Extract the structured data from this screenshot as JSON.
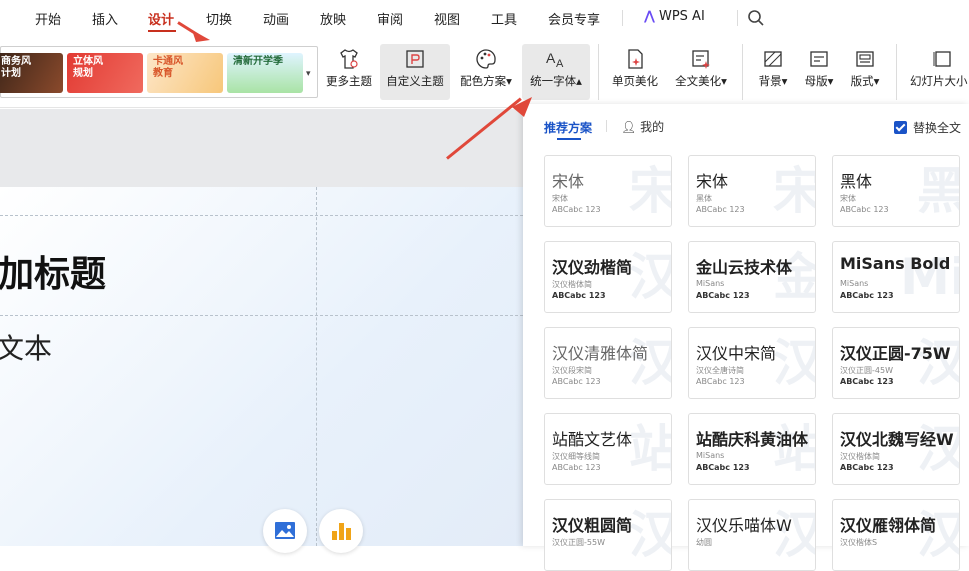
{
  "menubar": {
    "items": [
      "开始",
      "插入",
      "设计",
      "切换",
      "动画",
      "放映",
      "审阅",
      "视图",
      "工具",
      "会员专享"
    ],
    "active": "设计",
    "ai_label": "WPS AI"
  },
  "ribbon": {
    "themes": [
      {
        "label": "商务风\n计划",
        "color": "#6b3b2a"
      },
      {
        "label": "立体风\n规划",
        "color": "#e8473f"
      },
      {
        "label": "卡通风\n教育",
        "color": "#f5b340"
      },
      {
        "label": "清新开学季",
        "color": "#48b26b"
      }
    ],
    "buttons": {
      "more_themes": "更多主题",
      "custom_theme": "自定义主题",
      "color_scheme": "配色方案",
      "unify_font": "统一字体",
      "page_beautify": "单页美化",
      "full_beautify": "全文美化",
      "background": "背景",
      "master": "母版",
      "layout": "版式",
      "slide_size": "幻灯片大小"
    }
  },
  "slide": {
    "title": "加标题",
    "subtitle": "文本"
  },
  "font_panel": {
    "tab_recommended": "推荐方案",
    "tab_mine": "我的",
    "replace_all": "替换全文",
    "replace_all_checked": true,
    "cards": [
      {
        "name": "宋体",
        "sub": "宋体",
        "sample": "ABCabc 123",
        "wm": "宋",
        "light": true
      },
      {
        "name": "宋体",
        "sub": "黑体",
        "sample": "ABCabc 123",
        "wm": "宋"
      },
      {
        "name": "黑体",
        "sub": "宋体",
        "sample": "ABCabc 123",
        "wm": "黑"
      },
      {
        "name": "汉仪劲楷简",
        "sub": "汉仪楷体简",
        "sample": "ABCabc 123",
        "wm": "汉",
        "bold": true
      },
      {
        "name": "金山云技术体",
        "sub": "MiSans",
        "sample": "ABCabc 123",
        "wm": "金",
        "bold": true
      },
      {
        "name": "MiSans Bold",
        "sub": "MiSans",
        "sample": "ABCabc 123",
        "wm": "Mi",
        "bold": true
      },
      {
        "name": "汉仪清雅体简",
        "sub": "汉仪段宋简",
        "sample": "ABCabc 123",
        "wm": "汉",
        "light": true
      },
      {
        "name": "汉仪中宋简",
        "sub": "汉仪全唐诗简",
        "sample": "ABCabc 123",
        "wm": "汉"
      },
      {
        "name": "汉仪正圆-75W",
        "sub": "汉仪正圆-45W",
        "sample": "ABCabc 123",
        "wm": "汉",
        "bold": true
      },
      {
        "name": "站酷文艺体",
        "sub": "汉仪细等线简",
        "sample": "ABCabc 123",
        "wm": "站"
      },
      {
        "name": "站酷庆科黄油体",
        "sub": "MiSans",
        "sample": "ABCabc 123",
        "wm": "站",
        "bold": true
      },
      {
        "name": "汉仪北魏写经W",
        "sub": "汉仪楷体简",
        "sample": "ABCabc 123",
        "wm": "汉",
        "bold": true
      },
      {
        "name": "汉仪粗圆简",
        "sub": "汉仪正圆-55W",
        "sample": "",
        "wm": "汉",
        "bold": true
      },
      {
        "name": "汉仪乐喵体W",
        "sub": "幼圆",
        "sample": "",
        "wm": "汉"
      },
      {
        "name": "汉仪雁翎体简",
        "sub": "汉仪楷体S",
        "sample": "",
        "wm": "汉",
        "bold": true
      }
    ]
  },
  "colors": {
    "accent_red": "#c8301e",
    "accent_blue": "#1a53c7",
    "arrow": "#e0483a"
  }
}
